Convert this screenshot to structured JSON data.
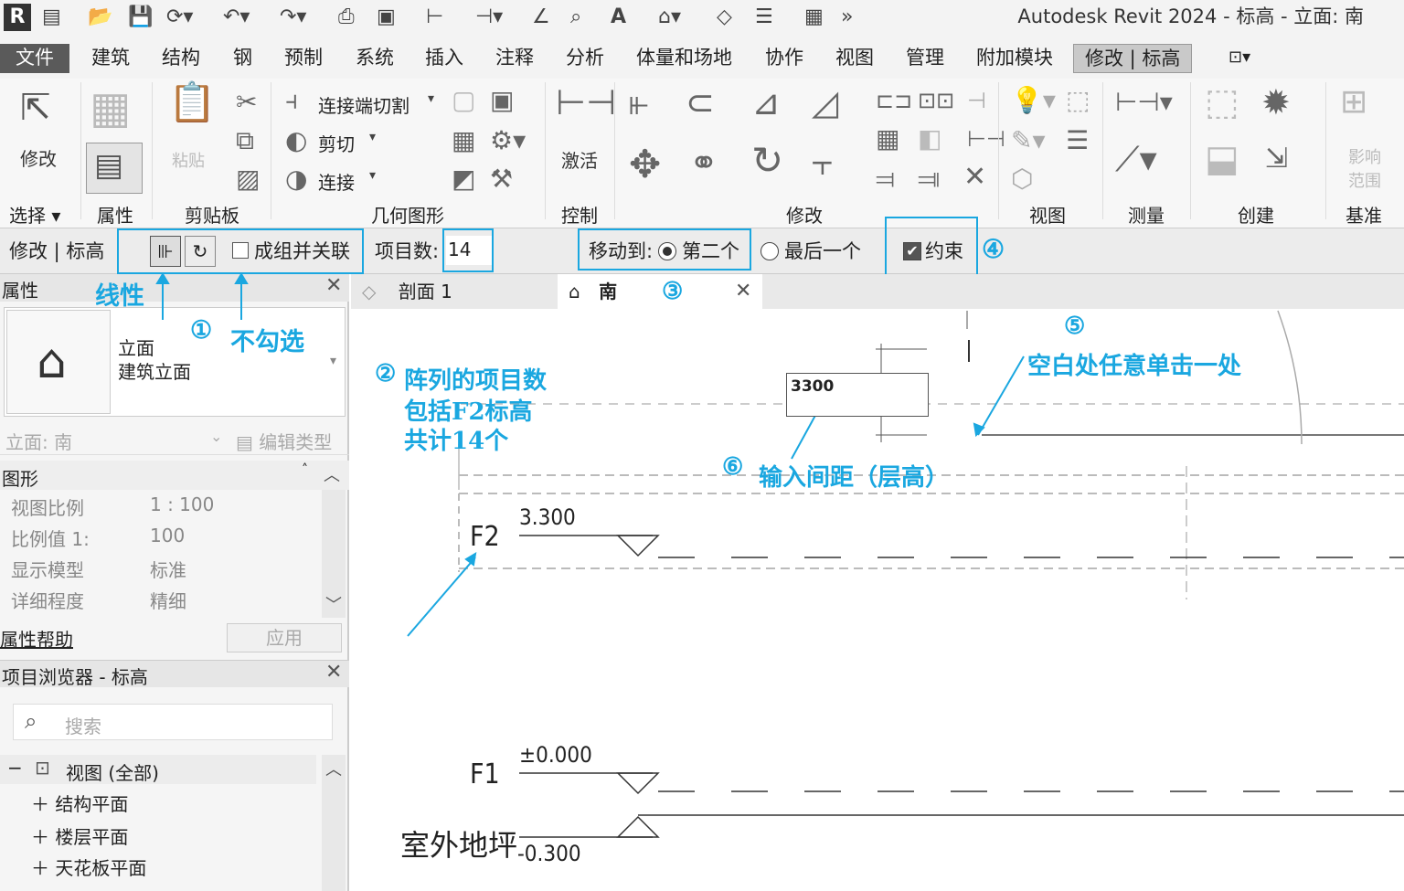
{
  "window": {
    "title": "Autodesk Revit 2024 - 标高 - 立面: 南",
    "logo": "R"
  },
  "menu": [
    "文件",
    "建筑",
    "结构",
    "钢",
    "预制",
    "系统",
    "插入",
    "注释",
    "分析",
    "体量和场地",
    "协作",
    "视图",
    "管理",
    "附加模块",
    "修改 | 标高"
  ],
  "ribbon": {
    "modify_label": "修改",
    "clipboard_paste": "粘贴",
    "geometry": {
      "cut_join": "连接端切割",
      "cut": "剪切",
      "join": "连接"
    },
    "activate": "激活",
    "influence": "影响\n范围",
    "panels": [
      "选择",
      "属性",
      "剪贴板",
      "几何图形",
      "控制",
      "修改",
      "视图",
      "测量",
      "创建",
      "基准"
    ]
  },
  "options_bar": {
    "context": "修改 | 标高",
    "group_assoc": "成组并关联",
    "count_label": "项目数:",
    "count_value": "14",
    "move_to": "移动到:",
    "second": "第二个",
    "last": "最后一个",
    "constrain": "约束"
  },
  "properties": {
    "header": "属性",
    "type_family": "立面",
    "type_name": "建筑立面",
    "selector": "立面: 南",
    "edit_type": "编辑类型",
    "group": "图形",
    "rows": [
      {
        "k": "视图比例",
        "v": "1 : 100"
      },
      {
        "k": "比例值 1:",
        "v": "100"
      },
      {
        "k": "显示模型",
        "v": "标准"
      },
      {
        "k": "详细程度",
        "v": "精细"
      }
    ],
    "help": "属性帮助",
    "apply": "应用"
  },
  "browser": {
    "header": "项目浏览器 - 标高",
    "search_placeholder": "搜索",
    "root": "视图 (全部)",
    "items": [
      "结构平面",
      "楼层平面",
      "天花板平面"
    ]
  },
  "tabs": {
    "section": "剖面 1",
    "south": "南"
  },
  "canvas": {
    "distance_input": "3300",
    "levels": [
      {
        "name": "F2",
        "elev": "3.300"
      },
      {
        "name": "F1",
        "elev": "±0.000"
      },
      {
        "name": "室外地坪",
        "elev": "-0.300"
      }
    ]
  },
  "annotations": {
    "n1": "①",
    "n2": "②",
    "n3": "③",
    "n4": "④",
    "n5": "⑤",
    "n6": "⑥",
    "linear": "线性",
    "uncheck": "不勾选",
    "count_note_1": "阵列的项目数",
    "count_note_2": "包括F2标高",
    "count_note_3": "共计14个",
    "click_blank": "空白处任意单击一处",
    "enter_spacing": "输入间距（层高）"
  },
  "colors": {
    "accent": "#1aa7e0"
  }
}
